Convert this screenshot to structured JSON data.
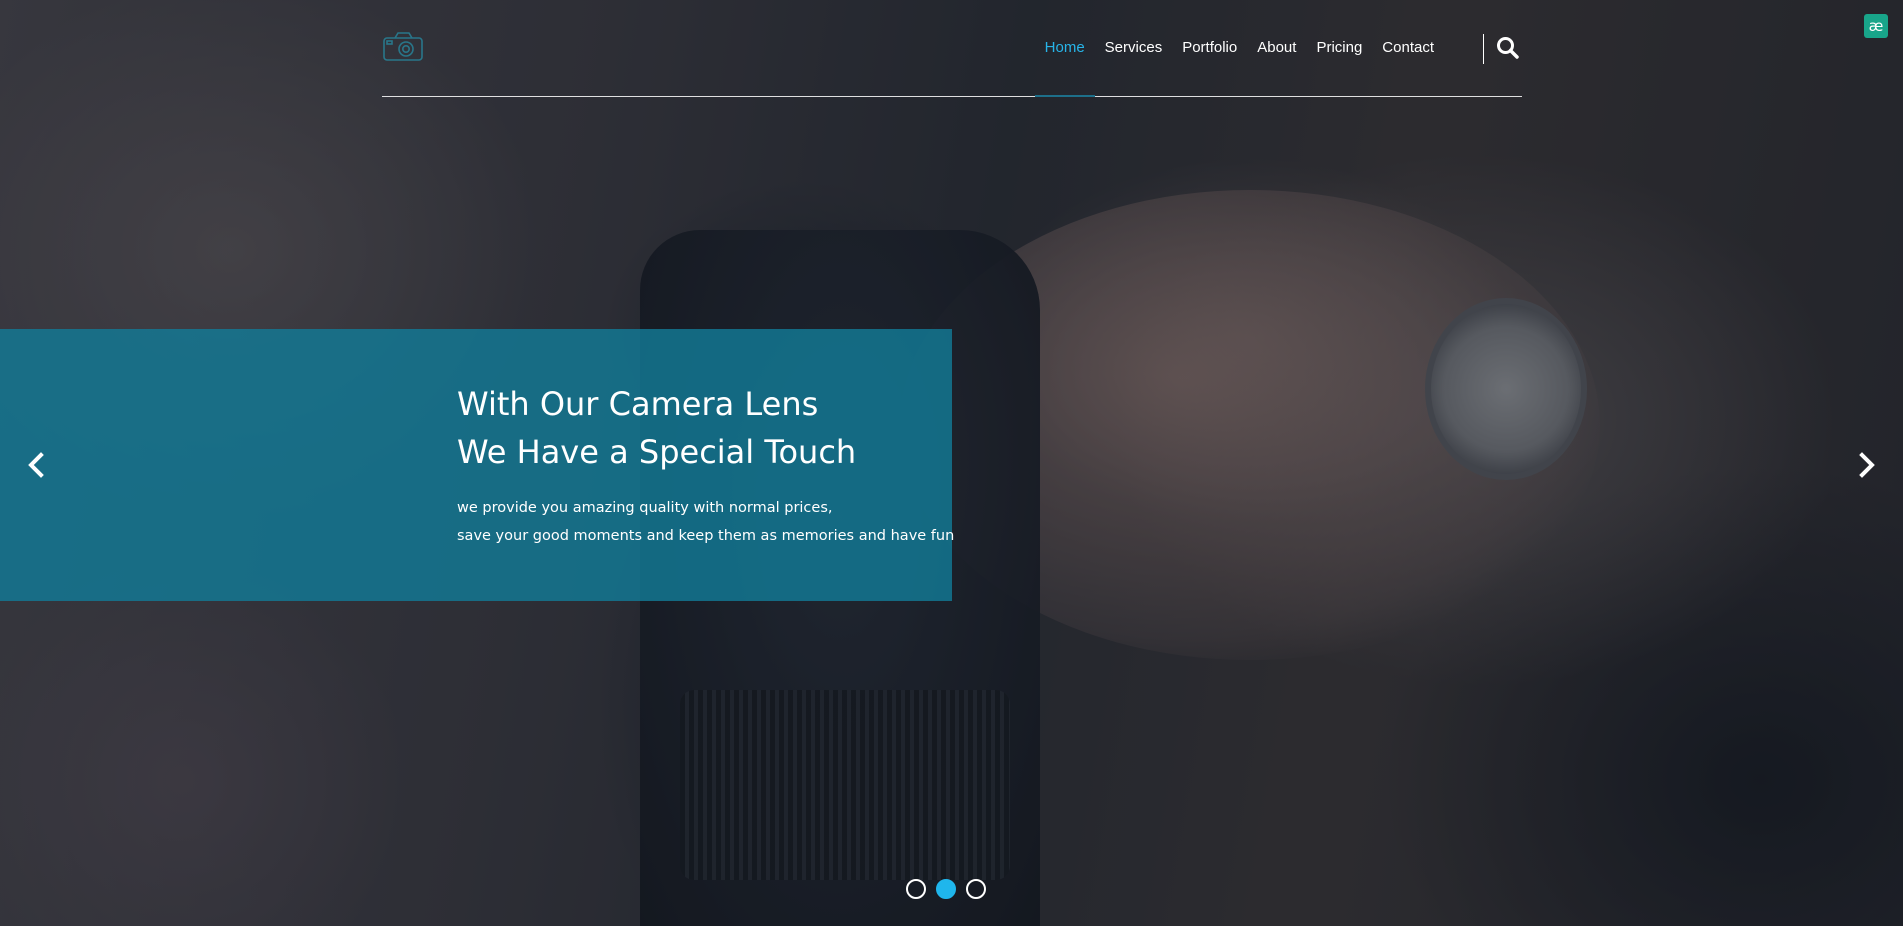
{
  "header": {
    "logo_icon": "camera-icon",
    "nav": [
      {
        "label": "Home",
        "active": true
      },
      {
        "label": "Services",
        "active": false
      },
      {
        "label": "Portfolio",
        "active": false
      },
      {
        "label": "About",
        "active": false
      },
      {
        "label": "Pricing",
        "active": false
      },
      {
        "label": "Contact",
        "active": false
      }
    ],
    "search_icon": "search-icon"
  },
  "corner_badge": {
    "label": "æ",
    "color": "#18a58a"
  },
  "slider": {
    "caption": {
      "title_line1": "With Our Camera Lens",
      "title_line2": "We Have a Special Touch",
      "text_line1": "we provide you amazing quality with normal prices,",
      "text_line2": "save your good moments and keep them as memories and have fun"
    },
    "prev_icon": "chevron-left-icon",
    "next_icon": "chevron-right-icon",
    "dots_count": 3,
    "active_dot": 2
  },
  "colors": {
    "accent": "#27b4e8",
    "caption_bg": "#127a96",
    "active_dot": "#1fb6ec",
    "text": "#ffffff"
  }
}
